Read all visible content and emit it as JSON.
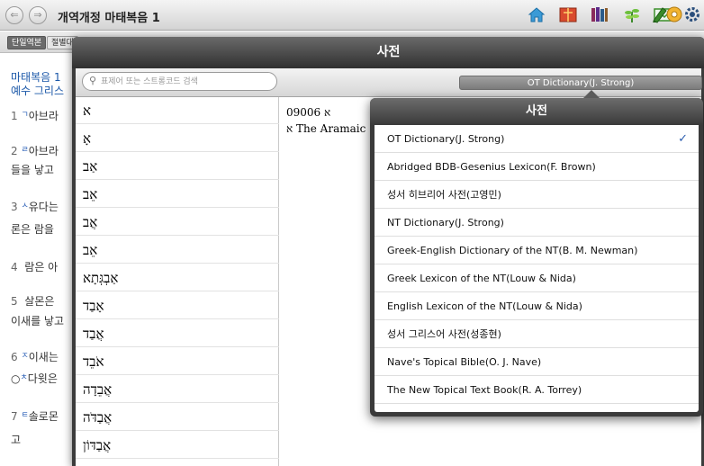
{
  "toolbar": {
    "back_icon": "back-arrow-icon",
    "forward_icon": "forward-arrow-icon",
    "title": "개역개정 마태복음 1",
    "icons": [
      "home-icon",
      "bible-book-icon",
      "library-icon",
      "plant-icon",
      "pen-icon",
      "media-icon",
      "notebook-icon",
      "help-icon",
      "gear-icon"
    ]
  },
  "tabstrip": {
    "tabs": [
      "단일역본",
      "절별대"
    ]
  },
  "bible": {
    "heading_line1": "마태복음 1",
    "heading_line2": "예수 그리스",
    "verses": [
      {
        "num": "1",
        "mark": "ㄱ",
        "text": "아브라"
      },
      {
        "num": "2",
        "mark": "ㄹ",
        "text": "아브라"
      },
      {
        "num": "",
        "mark": "",
        "text": "들을 낳고"
      },
      {
        "num": "3",
        "mark": "ㅅ",
        "text": "유다는"
      },
      {
        "num": "",
        "mark": "",
        "text": "론은 람을"
      },
      {
        "num": "4",
        "mark": "",
        "text": "람은 아"
      },
      {
        "num": "5",
        "mark": "",
        "text": "살몬은"
      },
      {
        "num": "",
        "mark": "",
        "text": "이새를 낳고"
      },
      {
        "num": "6",
        "mark": "ㅈ",
        "text": "이새는"
      },
      {
        "num": "",
        "mark": "ㅊ",
        "text": "다윗은"
      },
      {
        "num": "7",
        "mark": "ㅌ",
        "text": "솔로몬"
      },
      {
        "num": "",
        "mark": "",
        "text": "고"
      }
    ]
  },
  "dictionary": {
    "title": "사전",
    "search_placeholder": "표제어 또는 스트롱코드 검색",
    "selected_dictionary": "OT Dictionary(J. Strong)",
    "headwords": [
      "א",
      "אָ",
      "אַב",
      "אֵב",
      "אֲב",
      "אֵב",
      "אַבְגְּתָא",
      "אָבַד",
      "אֲבַד",
      "אֹבֵד",
      "אֲבֵדָה",
      "אֲבַדֹּה",
      "אֲבַדּוֹן"
    ],
    "entry_number": "09006 א",
    "entry_definition": "א The Aramaic"
  },
  "popover": {
    "title": "사전",
    "options": [
      "OT Dictionary(J. Strong)",
      "Abridged BDB-Gesenius Lexicon(F. Brown)",
      "성서 히브리어 사전(고영민)",
      "NT Dictionary(J. Strong)",
      "Greek-English Dictionary of the NT(B. M. Newman)",
      "Greek Lexicon of the NT(Louw & Nida)",
      "English Lexicon of the NT(Louw & Nida)",
      "성서 그리스어 사전(성종현)",
      "Nave's Topical Bible(O. J. Nave)",
      "The New Topical Text Book(R. A. Torrey)"
    ],
    "selected_index": 0,
    "check_mark": "✓"
  }
}
